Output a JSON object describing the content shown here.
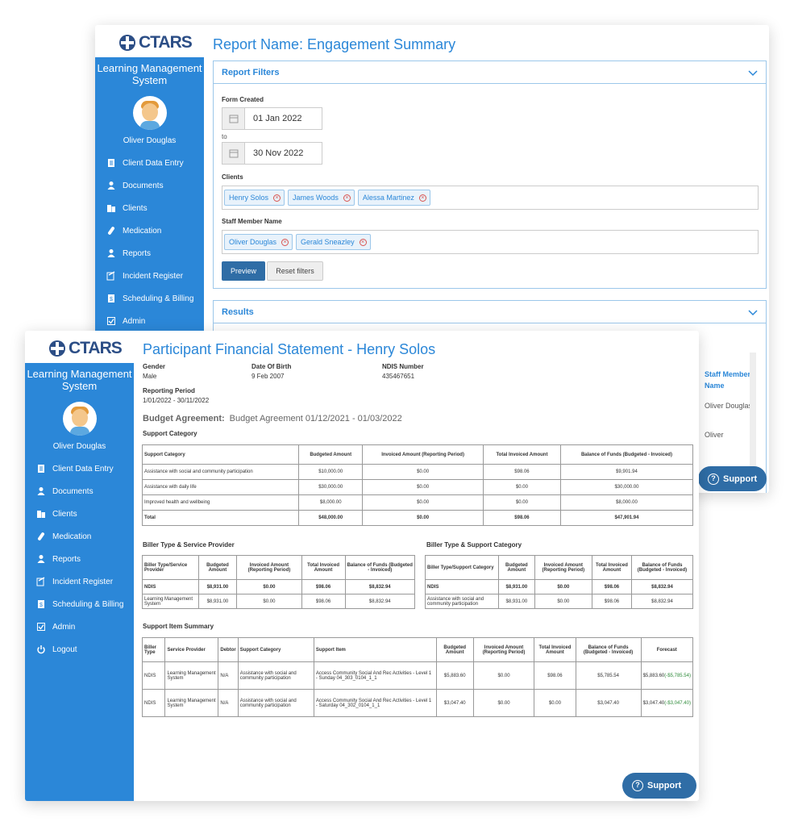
{
  "logo_text": "CTARS",
  "back": {
    "sidebar": {
      "title": "Learning Management System",
      "user": "Oliver Douglas",
      "items": [
        {
          "label": "Client Data Entry",
          "icon": "form-icon"
        },
        {
          "label": "Documents",
          "icon": "person-icon"
        },
        {
          "label": "Clients",
          "icon": "clients-icon"
        },
        {
          "label": "Medication",
          "icon": "pill-icon"
        },
        {
          "label": "Reports",
          "icon": "person-icon"
        },
        {
          "label": "Incident Register",
          "icon": "edit-icon"
        },
        {
          "label": "Scheduling & Billing",
          "icon": "billing-icon"
        },
        {
          "label": "Admin",
          "icon": "check-icon"
        }
      ]
    },
    "page_title": "Report Name: Engagement Summary",
    "filters": {
      "title": "Report Filters",
      "form_created_label": "Form Created",
      "date_from": "01 Jan 2022",
      "to_label": "to",
      "date_to": "30 Nov 2022",
      "clients_label": "Clients",
      "clients": [
        "Henry Solos",
        "James Woods",
        "Alessa Martinez"
      ],
      "staff_label": "Staff Member Name",
      "staff": [
        "Oliver Douglas",
        "Gerald Sneazley"
      ],
      "preview_label": "Preview",
      "reset_label": "Reset filters"
    },
    "results": {
      "title": "Results",
      "staff_header": "Staff Member Name",
      "staff_values": [
        "Oliver Douglas",
        "Oliver"
      ]
    },
    "support_label": "Support"
  },
  "front": {
    "sidebar": {
      "title": "Learning Management System",
      "user": "Oliver Douglas",
      "items": [
        {
          "label": "Client Data Entry",
          "icon": "form-icon"
        },
        {
          "label": "Documents",
          "icon": "person-icon"
        },
        {
          "label": "Clients",
          "icon": "clients-icon"
        },
        {
          "label": "Medication",
          "icon": "pill-icon"
        },
        {
          "label": "Reports",
          "icon": "person-icon"
        },
        {
          "label": "Incident Register",
          "icon": "edit-icon"
        },
        {
          "label": "Scheduling & Billing",
          "icon": "billing-icon"
        },
        {
          "label": "Admin",
          "icon": "check-icon"
        },
        {
          "label": "Logout",
          "icon": "power-icon"
        }
      ]
    },
    "page_title": "Participant Financial Statement - Henry Solos",
    "info": {
      "gender_label": "Gender",
      "gender": "Male",
      "dob_label": "Date Of Birth",
      "dob": "9 Feb 2007",
      "ndis_label": "NDIS Number",
      "ndis": "435467651",
      "period_label": "Reporting Period",
      "period": "1/01/2022 - 30/11/2022"
    },
    "budget_agreement_label": "Budget Agreement:",
    "budget_agreement": "Budget Agreement 01/12/2021 - 01/03/2022",
    "support_category": {
      "title": "Support Category",
      "headers": [
        "Support Category",
        "Budgeted Amount",
        "Invoiced Amount (Reporting Period)",
        "Total Invoiced Amount",
        "Balance of Funds (Budgeted - Invoiced)"
      ],
      "rows": [
        [
          "Assistance with social and community participation",
          "$10,000.00",
          "$0.00",
          "$98.06",
          "$9,901.94"
        ],
        [
          "Assistance with daily life",
          "$30,000.00",
          "$0.00",
          "$0.00",
          "$30,000.00"
        ],
        [
          "Improved health and wellbeing",
          "$8,000.00",
          "$0.00",
          "$0.00",
          "$8,000.00"
        ],
        [
          "Total",
          "$48,000.00",
          "$0.00",
          "$98.06",
          "$47,901.94"
        ]
      ]
    },
    "biller_provider": {
      "title": "Biller Type & Service Provider",
      "headers": [
        "Biller Type/Service Provider",
        "Budgeted Amount",
        "Invoiced Amount (Reporting Period)",
        "Total Invoiced Amount",
        "Balance of Funds (Budgeted - Invoiced)"
      ],
      "rows": [
        [
          "NDIS",
          "$8,931.00",
          "$0.00",
          "$98.06",
          "$8,832.94"
        ],
        [
          "Learning Management System",
          "$8,931.00",
          "$0.00",
          "$98.06",
          "$8,832.94"
        ]
      ]
    },
    "biller_category": {
      "title": "Biller Type & Support Category",
      "headers": [
        "Biller Type/Support Category",
        "Budgeted Amount",
        "Invoiced Amount (Reporting Period)",
        "Total Invoiced Amount",
        "Balance of Funds (Budgeted - Invoiced)"
      ],
      "rows": [
        [
          "NDIS",
          "$8,931.00",
          "$0.00",
          "$98.06",
          "$8,832.94"
        ],
        [
          "Assistance with social and community participation",
          "$8,931.00",
          "$0.00",
          "$98.06",
          "$8,832.94"
        ]
      ]
    },
    "item_summary": {
      "title": "Support Item Summary",
      "headers": [
        "Biller Type",
        "Service Provider",
        "Debtor",
        "Support Category",
        "Support Item",
        "Budgeted Amount",
        "Invoiced Amount (Reporting Period)",
        "Total Invoiced Amount",
        "Balance of Funds (Budgeted - Invoiced)",
        "Forecast"
      ],
      "rows": [
        [
          "NDIS",
          "Learning Management System",
          "N/A",
          "Assistance with social and community participation",
          "Access Community Social And Rec Activities - Level 1 - Sunday 04_303_0104_1_1",
          "$5,883.60",
          "$0.00",
          "$98.06",
          "$5,785.54",
          "$5,883.60",
          "(-$5,785.54)"
        ],
        [
          "NDIS",
          "Learning Management System",
          "N/A",
          "Assistance with social and community participation",
          "Access Community Social And Rec Activities - Level 1 - Saturday 04_302_0104_1_1",
          "$3,047.40",
          "$0.00",
          "$0.00",
          "$3,047.40",
          "$3,047.40",
          "(-$3,047.40)"
        ]
      ]
    },
    "support_label": "Support"
  },
  "colors": {
    "sidebar": "#2b87d8",
    "accent": "#2b87d8",
    "button": "#2f6da6",
    "forecast": "#2e8b3a"
  }
}
